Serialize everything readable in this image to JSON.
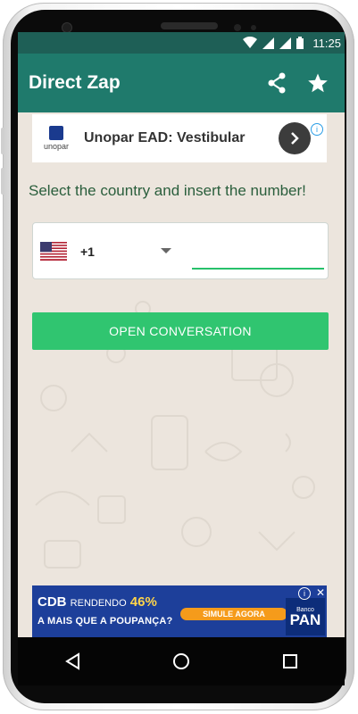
{
  "status_bar": {
    "time": "11:25",
    "icons": [
      "wifi-icon",
      "signal-icon",
      "signal-icon",
      "battery-icon"
    ]
  },
  "app_bar": {
    "title": "Direct Zap",
    "actions": [
      "share-icon",
      "star-icon"
    ]
  },
  "top_ad": {
    "logo_text": "unopar",
    "title": "Unopar EAD: Vestibular",
    "info_icon": "info-icon",
    "arrow_icon": "chevron-right-icon"
  },
  "main": {
    "instruction": "Select the country and insert the number!",
    "country": {
      "flag": "us-flag-icon",
      "code": "+1"
    },
    "number_input": {
      "value": "",
      "placeholder": ""
    },
    "open_button_label": "OPEN CONVERSATION"
  },
  "bottom_ad": {
    "headline_bold": "CDB",
    "headline_rest": "RENDENDO",
    "headline_pct": "46%",
    "subline": "A MAIS QUE A POUPANÇA?",
    "cta": "SIMULE AGORA",
    "logo_small": "Banco",
    "logo_big": "PAN"
  },
  "nav_bar": [
    "back-icon",
    "home-icon",
    "recents-icon"
  ],
  "colors": {
    "status_bar": "#1e5f56",
    "app_bar": "#1f7a6c",
    "background": "#ece5dd",
    "button": "#30c570",
    "ad_bottom": "#1d3f9a"
  }
}
